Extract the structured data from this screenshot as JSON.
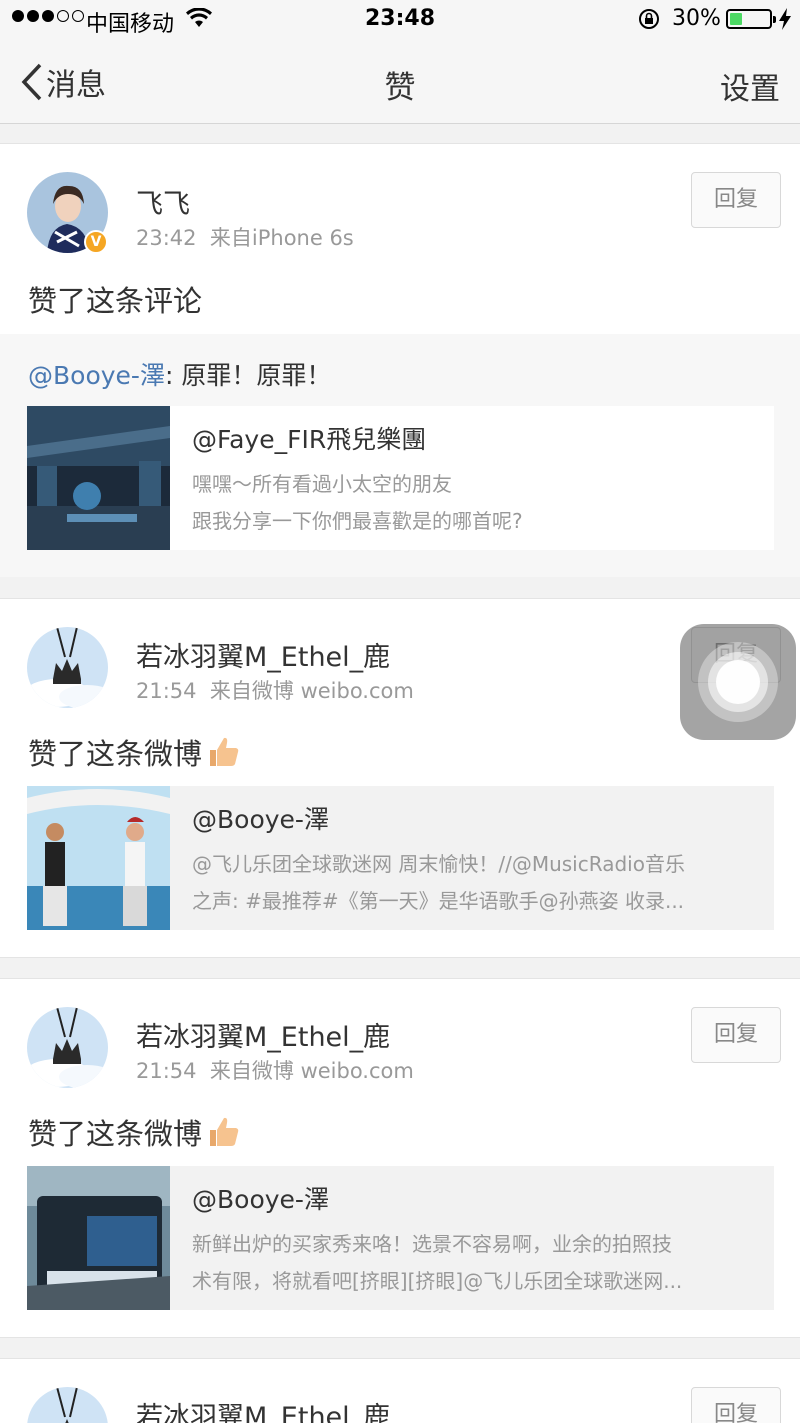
{
  "status_bar": {
    "carrier": "中国移动",
    "time": "23:48",
    "battery_percent": "30%"
  },
  "nav": {
    "back_label": "消息",
    "title": "赞",
    "settings_label": "设置"
  },
  "colors": {
    "mention": "#4a79b2",
    "verified_badge": "#f5a623",
    "battery_fill": "#4cd964"
  },
  "items": [
    {
      "username": "飞飞",
      "time": "23:42",
      "source": "来自iPhone 6s",
      "reply_label": "回复",
      "action": "赞了这条评论",
      "verified": true,
      "comment": {
        "mention": "@Booye-澤",
        "text": ": 原罪！原罪！"
      },
      "embed": {
        "title": "@Faye_FIR飛兒樂團",
        "line1": "嘿嘿～所有看過小太空的朋友",
        "line2": "跟我分享一下你們最喜歡是的哪首呢?"
      }
    },
    {
      "username": "若冰羽翼M_Ethel_鹿",
      "time": "21:54",
      "source": "来自微博 weibo.com",
      "reply_label": "回复",
      "action": "赞了这条微博",
      "embed": {
        "title": "@Booye-澤",
        "line1": "@飞儿乐团全球歌迷网 周末愉快！//@MusicRadio音乐",
        "line2": "之声: #最推荐#《第一天》是华语歌手@孙燕姿 收录..."
      }
    },
    {
      "username": "若冰羽翼M_Ethel_鹿",
      "time": "21:54",
      "source": "来自微博 weibo.com",
      "reply_label": "回复",
      "action": "赞了这条微博",
      "embed": {
        "title": "@Booye-澤",
        "line1": "新鲜出炉的买家秀来咯！选景不容易啊，业余的拍照技",
        "line2": "术有限，将就看吧[挤眼][挤眼]@飞儿乐团全球歌迷网..."
      }
    },
    {
      "username": "若冰羽翼M_Ethel_鹿",
      "reply_label": "回复"
    }
  ]
}
